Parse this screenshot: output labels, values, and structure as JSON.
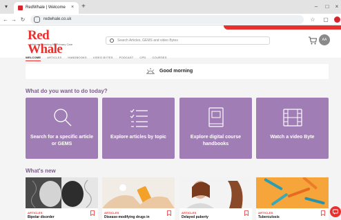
{
  "browser": {
    "tab_title": "RedWhale | Welcome",
    "url": "redwhale.co.uk",
    "new_tab": "+",
    "tab_close": "×"
  },
  "site": {
    "logo_text": "Red Whale",
    "logo_tagline": "Lifelong Learning for Primary Care",
    "search_placeholder": "Search Articles, GEMS and video Bytes",
    "avatar_initials": "AA",
    "nav": [
      "WELCOME",
      "ARTICLES",
      "HANDBOOKS",
      "VIDEO BYTES",
      "PODCAST",
      "CPD",
      "COURSES"
    ]
  },
  "greeting": "Good morning",
  "actions_title": "What do you want to do today?",
  "actions": [
    {
      "label": "Search for a specific article or GEMS",
      "icon": "search-icon"
    },
    {
      "label": "Explore articles by topic",
      "icon": "list-icon"
    },
    {
      "label": "Explore digital course handbooks",
      "icon": "book-icon"
    },
    {
      "label": "Watch a video Byte",
      "icon": "film-icon"
    }
  ],
  "whats_new_title": "What's new",
  "articles": [
    {
      "tag": "ARTICLES",
      "title": "Bipolar disorder"
    },
    {
      "tag": "ARTICLES",
      "title": "Disease-modifying drugs in"
    },
    {
      "tag": "ARTICLES",
      "title": "Delayed puberty"
    },
    {
      "tag": "ARTICLES",
      "title": "Tuberculosis"
    }
  ],
  "colors": {
    "brand_red": "#e8312f",
    "card_purple": "#a17db6",
    "heading_purple": "#7d5a8f"
  }
}
